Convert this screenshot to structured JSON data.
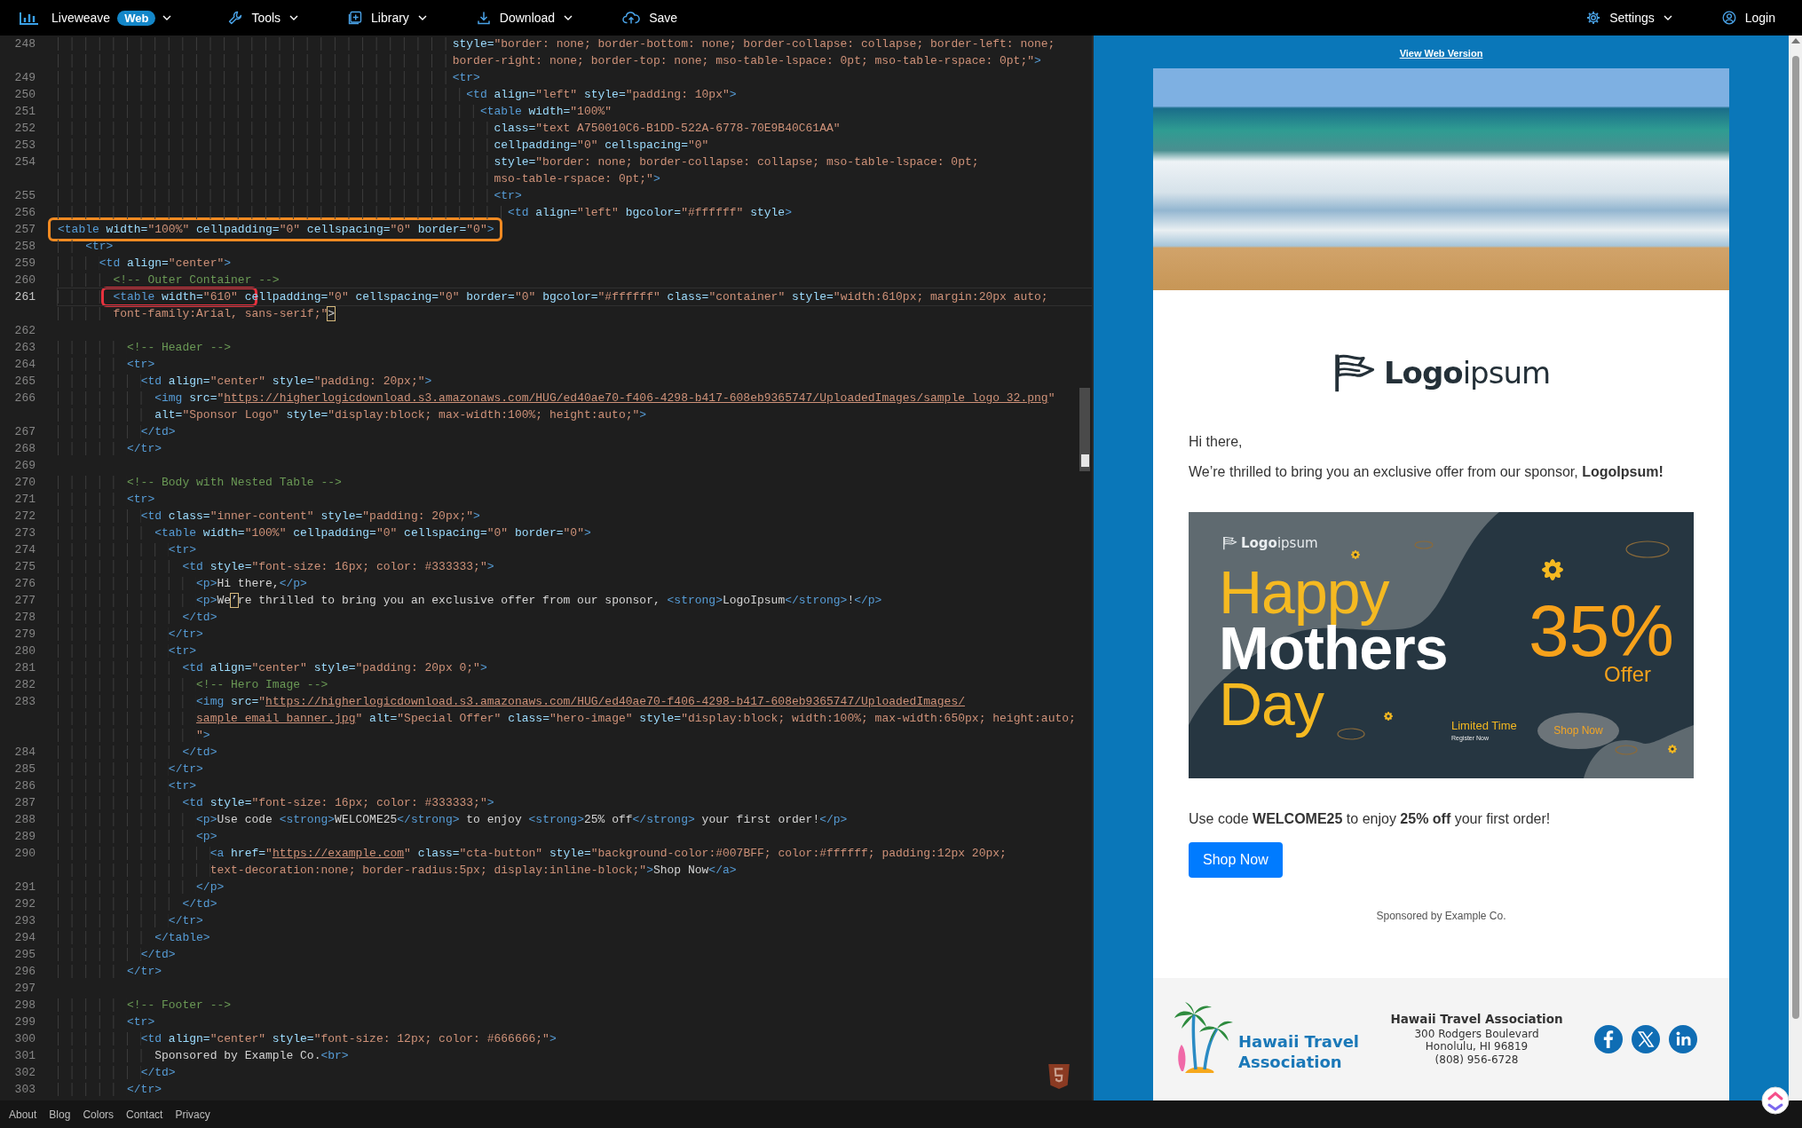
{
  "navbar": {
    "brand": "Liveweave",
    "badge": "Web",
    "brand_menu": true,
    "items": [
      {
        "label": "Tools",
        "has_menu": true
      },
      {
        "label": "Library",
        "has_menu": true
      },
      {
        "label": "Download",
        "has_menu": true
      },
      {
        "label": "Save",
        "has_menu": false
      }
    ],
    "right_items": [
      {
        "label": "Settings",
        "has_menu": true
      },
      {
        "label": "Login",
        "has_menu": false
      }
    ]
  },
  "editor": {
    "frames": [
      {
        "color": "#f28a22"
      },
      {
        "color": "#e6323e"
      }
    ],
    "lines": [
      {
        "number": "248",
        "current": false,
        "rows": [
          {
            "segments": [
              {
                "kind": "attr",
                "text": "                                                         style="
              },
              {
                "kind": "str",
                "text": "\"border: none; border-bottom: none; border-collapse: collapse; border-left: none;"
              }
            ]
          },
          {
            "segments": [
              {
                "kind": "str",
                "text": "                                                         border-right: none; border-top: none; mso-table-lspace: 0pt; mso-table-rspace: 0pt;\""
              },
              {
                "kind": "tag",
                "text": ">"
              }
            ]
          }
        ]
      },
      {
        "number": "249",
        "current": false,
        "rows": [
          {
            "segments": [
              {
                "kind": "tag",
                "text": "                                                         <tr>"
              }
            ]
          }
        ]
      },
      {
        "number": "250",
        "current": false,
        "rows": [
          {
            "segments": [
              {
                "kind": "tag",
                "text": "                                                           <td"
              },
              {
                "kind": "attr",
                "text": " align="
              },
              {
                "kind": "str",
                "text": "\"left\""
              },
              {
                "kind": "attr",
                "text": " style="
              },
              {
                "kind": "str",
                "text": "\"padding: 10px\""
              },
              {
                "kind": "tag",
                "text": ">"
              }
            ]
          }
        ]
      },
      {
        "number": "251",
        "current": false,
        "rows": [
          {
            "segments": [
              {
                "kind": "tag",
                "text": "                                                             <table"
              },
              {
                "kind": "attr",
                "text": " width="
              },
              {
                "kind": "str",
                "text": "\"100%\""
              }
            ]
          }
        ]
      },
      {
        "number": "252",
        "current": false,
        "rows": [
          {
            "segments": [
              {
                "kind": "attr",
                "text": "                                                               class="
              },
              {
                "kind": "str",
                "text": "\"text A750010C6-B1DD-522A-6778-70E9B40C61AA\""
              }
            ]
          }
        ]
      },
      {
        "number": "253",
        "current": false,
        "rows": [
          {
            "segments": [
              {
                "kind": "attr",
                "text": "                                                               cellpadding="
              },
              {
                "kind": "str",
                "text": "\"0\""
              },
              {
                "kind": "attr",
                "text": " cellspacing="
              },
              {
                "kind": "str",
                "text": "\"0\""
              }
            ]
          }
        ]
      },
      {
        "number": "254",
        "current": false,
        "rows": [
          {
            "segments": [
              {
                "kind": "attr",
                "text": "                                                               style="
              },
              {
                "kind": "str",
                "text": "\"border: none; border-collapse: collapse; mso-table-lspace: 0pt;"
              }
            ]
          },
          {
            "segments": [
              {
                "kind": "str",
                "text": "                                                               mso-table-rspace: 0pt;\""
              },
              {
                "kind": "tag",
                "text": ">"
              }
            ]
          }
        ]
      },
      {
        "number": "255",
        "current": false,
        "rows": [
          {
            "segments": [
              {
                "kind": "tag",
                "text": "                                                               <tr>"
              }
            ]
          }
        ]
      },
      {
        "number": "256",
        "current": false,
        "rows": [
          {
            "segments": [
              {
                "kind": "tag",
                "text": "                                                                 <td"
              },
              {
                "kind": "attr",
                "text": " align="
              },
              {
                "kind": "str",
                "text": "\"left\""
              },
              {
                "kind": "attr",
                "text": " bgcolor="
              },
              {
                "kind": "str",
                "text": "\"#ffffff\""
              },
              {
                "kind": "attr",
                "text": " style"
              },
              {
                "kind": "tag",
                "text": ">"
              }
            ]
          }
        ]
      },
      {
        "number": "257",
        "current": false,
        "rows": [
          {
            "segments": [
              {
                "kind": "tag",
                "text": "<table"
              },
              {
                "kind": "attr",
                "text": " width="
              },
              {
                "kind": "str",
                "text": "\"100%\""
              },
              {
                "kind": "attr",
                "text": " cellpadding="
              },
              {
                "kind": "str",
                "text": "\"0\""
              },
              {
                "kind": "attr",
                "text": " cellspacing="
              },
              {
                "kind": "str",
                "text": "\"0\""
              },
              {
                "kind": "attr",
                "text": " border="
              },
              {
                "kind": "str",
                "text": "\"0\""
              },
              {
                "kind": "tag",
                "text": ">"
              }
            ]
          }
        ]
      },
      {
        "number": "258",
        "current": false,
        "rows": [
          {
            "segments": [
              {
                "kind": "tag",
                "text": "    <tr>"
              }
            ]
          }
        ]
      },
      {
        "number": "259",
        "current": false,
        "rows": [
          {
            "segments": [
              {
                "kind": "tag",
                "text": "      <td"
              },
              {
                "kind": "attr",
                "text": " align="
              },
              {
                "kind": "str",
                "text": "\"center\""
              },
              {
                "kind": "tag",
                "text": ">"
              }
            ]
          }
        ]
      },
      {
        "number": "260",
        "current": false,
        "rows": [
          {
            "segments": [
              {
                "kind": "comment",
                "text": "        <!-- Outer Container -->"
              }
            ]
          }
        ]
      },
      {
        "number": "261",
        "current": true,
        "rows": [
          {
            "segments": [
              {
                "kind": "tag",
                "text": "        <table"
              },
              {
                "kind": "attr",
                "text": " width="
              },
              {
                "kind": "str",
                "text": "\"610\""
              },
              {
                "kind": "attr",
                "text": " cellpadding="
              },
              {
                "kind": "str",
                "text": "\"0\""
              },
              {
                "kind": "attr",
                "text": " cellspacing="
              },
              {
                "kind": "str",
                "text": "\"0\""
              },
              {
                "kind": "attr",
                "text": " border="
              },
              {
                "kind": "str",
                "text": "\"0\""
              },
              {
                "kind": "attr",
                "text": " bgcolor="
              },
              {
                "kind": "str",
                "text": "\"#ffffff\""
              },
              {
                "kind": "attr",
                "text": " class="
              },
              {
                "kind": "str",
                "text": "\"container\""
              },
              {
                "kind": "attr",
                "text": " style="
              },
              {
                "kind": "str",
                "text": "\"width:610px; margin:20px auto;"
              }
            ]
          },
          {
            "segments": [
              {
                "kind": "str",
                "text": "        font-family:Arial, sans-serif;\""
              },
              {
                "kind": "flagged",
                "text": ">"
              }
            ]
          }
        ]
      },
      {
        "number": "262",
        "current": false
      },
      {
        "number": "263",
        "current": false,
        "rows": [
          {
            "segments": [
              {
                "kind": "comment",
                "text": "          <!-- Header -->"
              }
            ]
          }
        ]
      },
      {
        "number": "264",
        "current": false,
        "rows": [
          {
            "segments": [
              {
                "kind": "tag",
                "text": "          <tr>"
              }
            ]
          }
        ]
      },
      {
        "number": "265",
        "current": false,
        "rows": [
          {
            "segments": [
              {
                "kind": "tag",
                "text": "            <td"
              },
              {
                "kind": "attr",
                "text": " align="
              },
              {
                "kind": "str",
                "text": "\"center\""
              },
              {
                "kind": "attr",
                "text": " style="
              },
              {
                "kind": "str",
                "text": "\"padding: 20px;\""
              },
              {
                "kind": "tag",
                "text": ">"
              }
            ]
          }
        ]
      },
      {
        "number": "266",
        "current": false,
        "rows": [
          {
            "segments": [
              {
                "kind": "tag",
                "text": "              <img"
              },
              {
                "kind": "attr",
                "text": " src="
              },
              {
                "kind": "str",
                "text": "\""
              },
              {
                "kind": "url",
                "text": "https://higherlogicdownload.s3.amazonaws.com/HUG/ed40ae70-f406-4298-b417-608eb9365747/UploadedImages/sample_logo_32.png"
              },
              {
                "kind": "str",
                "text": "\""
              }
            ]
          },
          {
            "segments": [
              {
                "kind": "attr",
                "text": "              alt="
              },
              {
                "kind": "str",
                "text": "\"Sponsor Logo\""
              },
              {
                "kind": "attr",
                "text": " style="
              },
              {
                "kind": "str",
                "text": "\"display:block; max-width:100%; height:auto;\""
              },
              {
                "kind": "tag",
                "text": ">"
              }
            ]
          }
        ]
      },
      {
        "number": "267",
        "current": false,
        "rows": [
          {
            "segments": [
              {
                "kind": "tag",
                "text": "            </td>"
              }
            ]
          }
        ]
      },
      {
        "number": "268",
        "current": false,
        "rows": [
          {
            "segments": [
              {
                "kind": "tag",
                "text": "          </tr>"
              }
            ]
          }
        ]
      },
      {
        "number": "269",
        "current": false
      },
      {
        "number": "270",
        "current": false,
        "rows": [
          {
            "segments": [
              {
                "kind": "comment",
                "text": "          <!-- Body with Nested Table -->"
              }
            ]
          }
        ]
      },
      {
        "number": "271",
        "current": false,
        "rows": [
          {
            "segments": [
              {
                "kind": "tag",
                "text": "          <tr>"
              }
            ]
          }
        ]
      },
      {
        "number": "272",
        "current": false,
        "rows": [
          {
            "segments": [
              {
                "kind": "tag",
                "text": "            <td"
              },
              {
                "kind": "attr",
                "text": " class="
              },
              {
                "kind": "str",
                "text": "\"inner-content\""
              },
              {
                "kind": "attr",
                "text": " style="
              },
              {
                "kind": "str",
                "text": "\"padding: 20px;\""
              },
              {
                "kind": "tag",
                "text": ">"
              }
            ]
          }
        ]
      },
      {
        "number": "273",
        "current": false,
        "rows": [
          {
            "segments": [
              {
                "kind": "tag",
                "text": "              <table"
              },
              {
                "kind": "attr",
                "text": " width="
              },
              {
                "kind": "str",
                "text": "\"100%\""
              },
              {
                "kind": "attr",
                "text": " cellpadding="
              },
              {
                "kind": "str",
                "text": "\"0\""
              },
              {
                "kind": "attr",
                "text": " cellspacing="
              },
              {
                "kind": "str",
                "text": "\"0\""
              },
              {
                "kind": "attr",
                "text": " border="
              },
              {
                "kind": "str",
                "text": "\"0\""
              },
              {
                "kind": "tag",
                "text": ">"
              }
            ]
          }
        ]
      },
      {
        "number": "274",
        "current": false,
        "rows": [
          {
            "segments": [
              {
                "kind": "tag",
                "text": "                <tr>"
              }
            ]
          }
        ]
      },
      {
        "number": "275",
        "current": false,
        "rows": [
          {
            "segments": [
              {
                "kind": "tag",
                "text": "                  <td"
              },
              {
                "kind": "attr",
                "text": " style="
              },
              {
                "kind": "str",
                "text": "\"font-size: 16px; color: #333333;\""
              },
              {
                "kind": "tag",
                "text": ">"
              }
            ]
          }
        ]
      },
      {
        "number": "276",
        "current": false,
        "rows": [
          {
            "segments": [
              {
                "kind": "tag",
                "text": "                    <p>"
              },
              {
                "kind": "text",
                "text": "Hi there,"
              },
              {
                "kind": "tag",
                "text": "</p>"
              }
            ]
          }
        ]
      },
      {
        "number": "277",
        "current": false,
        "rows": [
          {
            "segments": [
              {
                "kind": "tag",
                "text": "                    <p>"
              },
              {
                "kind": "text",
                "text": "We"
              },
              {
                "kind": "flagged",
                "text": "’"
              },
              {
                "kind": "text",
                "text": "re thrilled to bring you an exclusive offer from our sponsor, "
              },
              {
                "kind": "tag",
                "text": "<strong>"
              },
              {
                "kind": "text",
                "text": "LogoIpsum"
              },
              {
                "kind": "tag",
                "text": "</strong>"
              },
              {
                "kind": "text",
                "text": "!"
              },
              {
                "kind": "tag",
                "text": "</p>"
              }
            ]
          }
        ]
      },
      {
        "number": "278",
        "current": false,
        "rows": [
          {
            "segments": [
              {
                "kind": "tag",
                "text": "                  </td>"
              }
            ]
          }
        ]
      },
      {
        "number": "279",
        "current": false,
        "rows": [
          {
            "segments": [
              {
                "kind": "tag",
                "text": "                </tr>"
              }
            ]
          }
        ]
      },
      {
        "number": "280",
        "current": false,
        "rows": [
          {
            "segments": [
              {
                "kind": "tag",
                "text": "                <tr>"
              }
            ]
          }
        ]
      },
      {
        "number": "281",
        "current": false,
        "rows": [
          {
            "segments": [
              {
                "kind": "tag",
                "text": "                  <td"
              },
              {
                "kind": "attr",
                "text": " align="
              },
              {
                "kind": "str",
                "text": "\"center\""
              },
              {
                "kind": "attr",
                "text": " style="
              },
              {
                "kind": "str",
                "text": "\"padding: 20px 0;\""
              },
              {
                "kind": "tag",
                "text": ">"
              }
            ]
          }
        ]
      },
      {
        "number": "282",
        "current": false,
        "rows": [
          {
            "segments": [
              {
                "kind": "comment",
                "text": "                    <!-- Hero Image -->"
              }
            ]
          }
        ]
      },
      {
        "number": "283",
        "current": false,
        "rows": [
          {
            "segments": [
              {
                "kind": "tag",
                "text": "                    <img"
              },
              {
                "kind": "attr",
                "text": " src="
              },
              {
                "kind": "str",
                "text": "\""
              },
              {
                "kind": "url",
                "text": "https://higherlogicdownload.s3.amazonaws.com/HUG/ed40ae70-f406-4298-b417-608eb9365747/UploadedImages/"
              }
            ]
          },
          {
            "segments": [
              {
                "kind": "url",
                "text": "                    sample_email_banner.jpg"
              },
              {
                "kind": "str",
                "text": "\""
              },
              {
                "kind": "attr",
                "text": " alt="
              },
              {
                "kind": "str",
                "text": "\"Special Offer\""
              },
              {
                "kind": "attr",
                "text": " class="
              },
              {
                "kind": "str",
                "text": "\"hero-image\""
              },
              {
                "kind": "attr",
                "text": " style="
              },
              {
                "kind": "str",
                "text": "\"display:block; width:100%; max-width:650px; height:auto;"
              }
            ]
          },
          {
            "segments": [
              {
                "kind": "str",
                "text": "                    \""
              },
              {
                "kind": "tag",
                "text": ">"
              }
            ]
          }
        ]
      },
      {
        "number": "284",
        "current": false,
        "rows": [
          {
            "segments": [
              {
                "kind": "tag",
                "text": "                  </td>"
              }
            ]
          }
        ]
      },
      {
        "number": "285",
        "current": false,
        "rows": [
          {
            "segments": [
              {
                "kind": "tag",
                "text": "                </tr>"
              }
            ]
          }
        ]
      },
      {
        "number": "286",
        "current": false,
        "rows": [
          {
            "segments": [
              {
                "kind": "tag",
                "text": "                <tr>"
              }
            ]
          }
        ]
      },
      {
        "number": "287",
        "current": false,
        "rows": [
          {
            "segments": [
              {
                "kind": "tag",
                "text": "                  <td"
              },
              {
                "kind": "attr",
                "text": " style="
              },
              {
                "kind": "str",
                "text": "\"font-size: 16px; color: #333333;\""
              },
              {
                "kind": "tag",
                "text": ">"
              }
            ]
          }
        ]
      },
      {
        "number": "288",
        "current": false,
        "rows": [
          {
            "segments": [
              {
                "kind": "tag",
                "text": "                    <p>"
              },
              {
                "kind": "text",
                "text": "Use code "
              },
              {
                "kind": "tag",
                "text": "<strong>"
              },
              {
                "kind": "text",
                "text": "WELCOME25"
              },
              {
                "kind": "tag",
                "text": "</strong>"
              },
              {
                "kind": "text",
                "text": " to enjoy "
              },
              {
                "kind": "tag",
                "text": "<strong>"
              },
              {
                "kind": "text",
                "text": "25% off"
              },
              {
                "kind": "tag",
                "text": "</strong>"
              },
              {
                "kind": "text",
                "text": " your first order!"
              },
              {
                "kind": "tag",
                "text": "</p>"
              }
            ]
          }
        ]
      },
      {
        "number": "289",
        "current": false,
        "rows": [
          {
            "segments": [
              {
                "kind": "tag",
                "text": "                    <p>"
              }
            ]
          }
        ]
      },
      {
        "number": "290",
        "current": false,
        "rows": [
          {
            "segments": [
              {
                "kind": "tag",
                "text": "                      <a"
              },
              {
                "kind": "attr",
                "text": " href="
              },
              {
                "kind": "str",
                "text": "\""
              },
              {
                "kind": "url",
                "text": "https://example.com"
              },
              {
                "kind": "str",
                "text": "\""
              },
              {
                "kind": "attr",
                "text": " class="
              },
              {
                "kind": "str",
                "text": "\"cta-button\""
              },
              {
                "kind": "attr",
                "text": " style="
              },
              {
                "kind": "str",
                "text": "\"background-color:#007BFF; color:#ffffff; padding:12px 20px;"
              }
            ]
          },
          {
            "segments": [
              {
                "kind": "str",
                "text": "                      text-decoration:none; border-radius:5px; display:inline-block;\""
              },
              {
                "kind": "tag",
                "text": ">"
              },
              {
                "kind": "text",
                "text": "Shop Now"
              },
              {
                "kind": "tag",
                "text": "</a>"
              }
            ]
          }
        ]
      },
      {
        "number": "291",
        "current": false,
        "rows": [
          {
            "segments": [
              {
                "kind": "tag",
                "text": "                    </p>"
              }
            ]
          }
        ]
      },
      {
        "number": "292",
        "current": false,
        "rows": [
          {
            "segments": [
              {
                "kind": "tag",
                "text": "                  </td>"
              }
            ]
          }
        ]
      },
      {
        "number": "293",
        "current": false,
        "rows": [
          {
            "segments": [
              {
                "kind": "tag",
                "text": "                </tr>"
              }
            ]
          }
        ]
      },
      {
        "number": "294",
        "current": false,
        "rows": [
          {
            "segments": [
              {
                "kind": "tag",
                "text": "              </table>"
              }
            ]
          }
        ]
      },
      {
        "number": "295",
        "current": false,
        "rows": [
          {
            "segments": [
              {
                "kind": "tag",
                "text": "            </td>"
              }
            ]
          }
        ]
      },
      {
        "number": "296",
        "current": false,
        "rows": [
          {
            "segments": [
              {
                "kind": "tag",
                "text": "          </tr>"
              }
            ]
          }
        ]
      },
      {
        "number": "297",
        "current": false
      },
      {
        "number": "298",
        "current": false,
        "rows": [
          {
            "segments": [
              {
                "kind": "comment",
                "text": "          <!-- Footer -->"
              }
            ]
          }
        ]
      },
      {
        "number": "299",
        "current": false,
        "rows": [
          {
            "segments": [
              {
                "kind": "tag",
                "text": "          <tr>"
              }
            ]
          }
        ]
      },
      {
        "number": "300",
        "current": false,
        "rows": [
          {
            "segments": [
              {
                "kind": "tag",
                "text": "            <td"
              },
              {
                "kind": "attr",
                "text": " align="
              },
              {
                "kind": "str",
                "text": "\"center\""
              },
              {
                "kind": "attr",
                "text": " style="
              },
              {
                "kind": "str",
                "text": "\"font-size: 12px; color: #666666;\""
              },
              {
                "kind": "tag",
                "text": ">"
              }
            ]
          }
        ]
      },
      {
        "number": "301",
        "current": false,
        "rows": [
          {
            "segments": [
              {
                "kind": "text",
                "text": "              Sponsored by Example Co."
              },
              {
                "kind": "tag",
                "text": "<br>"
              }
            ]
          }
        ]
      },
      {
        "number": "302",
        "current": false,
        "rows": [
          {
            "segments": [
              {
                "kind": "tag",
                "text": "            </td>"
              }
            ]
          }
        ]
      },
      {
        "number": "303",
        "current": false,
        "rows": [
          {
            "segments": [
              {
                "kind": "tag",
                "text": "          </tr>"
              }
            ]
          }
        ]
      }
    ]
  },
  "preview": {
    "view_link": "View Web Version",
    "logo": "**Logo**ipsum",
    "greeting": "Hi there,",
    "intro": "We’re thrilled to bring you an exclusive offer from our sponsor, **LogoIpsum!**",
    "banner": {
      "logo": "**Logo**ipsum",
      "title": [
        {
          "text": "Happy",
          "kind": "accent"
        },
        {
          "text": "Mothers",
          "kind": "strong"
        },
        {
          "text": "Day",
          "kind": "accent"
        }
      ],
      "discount": "35%",
      "discount_label": "Offer",
      "note": "Limited Time",
      "note_sub": "Register Now",
      "button": "Shop Now"
    },
    "offer": "Use code **WELCOME25** to enjoy **25% off** your first order!",
    "cta": "Shop Now",
    "sponsor": "Sponsored by Example Co.",
    "footer": {
      "logo_lines": [
        "Hawaii Travel",
        "Association"
      ],
      "org": "Hawaii Travel Association",
      "address": [
        "300 Rodgers Boulevard",
        "Honolulu, HI 96819",
        "(808) 956-6728"
      ]
    }
  },
  "footer_links": [
    "About",
    "Blog",
    "Colors",
    "Contact",
    "Privacy"
  ]
}
